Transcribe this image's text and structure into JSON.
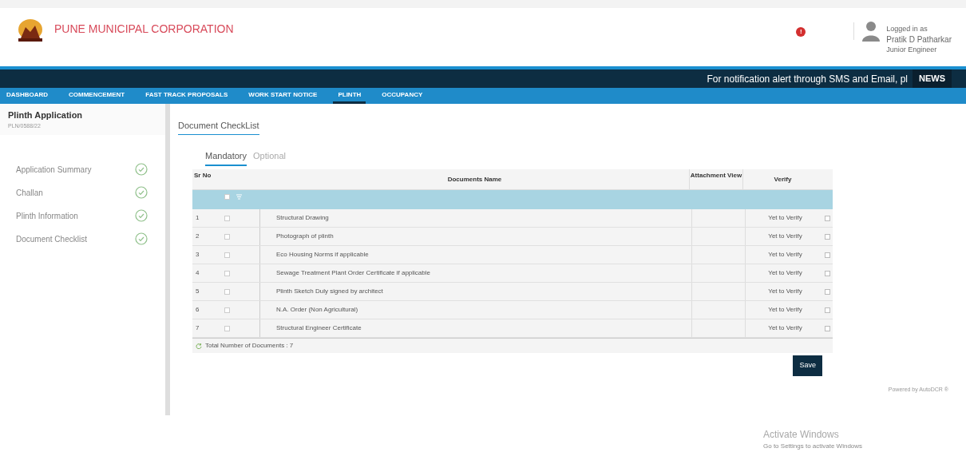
{
  "header": {
    "title": "PUNE MUNICIPAL CORPORATION",
    "alert_count": "!",
    "user": {
      "caption": "Logged in as",
      "name": "Pratik D Patharkar",
      "role": "Junior Engineer"
    }
  },
  "ticker": {
    "text": "For notification alert through SMS and Email, pl",
    "badge": "NEWS"
  },
  "nav": [
    {
      "label": "DASHBOARD",
      "selected": false
    },
    {
      "label": "COMMENCEMENT",
      "selected": false
    },
    {
      "label": "FAST TRACK PROPOSALS",
      "selected": false
    },
    {
      "label": "WORK START NOTICE",
      "selected": false
    },
    {
      "label": "PLINTH",
      "selected": true
    },
    {
      "label": "OCCUPANCY",
      "selected": false
    }
  ],
  "sidebar": {
    "title": "Plinth Application",
    "subtitle": "PLN/0588/22",
    "items": [
      {
        "label": "Application Summary",
        "done": true
      },
      {
        "label": "Challan",
        "done": true
      },
      {
        "label": "Plinth Information",
        "done": true
      },
      {
        "label": "Document Checklist",
        "done": true
      }
    ]
  },
  "page_title": "Document CheckList",
  "tabs": [
    {
      "label": "Mandatory",
      "selected": true
    },
    {
      "label": "Optional",
      "selected": false
    }
  ],
  "table": {
    "all_checked": false,
    "columns": [
      "Sr No",
      "Documents Name",
      "Attachment View",
      "Verify"
    ],
    "rows": [
      {
        "no": "1",
        "name": "Structural Drawing",
        "verify": "Yet to Verify",
        "checked": false
      },
      {
        "no": "2",
        "name": "Photograph of plinth",
        "verify": "Yet to Verify",
        "checked": false
      },
      {
        "no": "3",
        "name": "Eco Housing Norms if applicable",
        "verify": "Yet to Verify",
        "checked": false
      },
      {
        "no": "4",
        "name": "Sewage Treatment Plant  Order Certificate if applicable",
        "verify": "Yet to Verify",
        "checked": false
      },
      {
        "no": "5",
        "name": "Plinth Sketch Duly signed by architect",
        "verify": "Yet to Verify",
        "checked": false
      },
      {
        "no": "6",
        "name": "N.A. Order (Non Agricultural)",
        "verify": "Yet to Verify",
        "checked": false
      },
      {
        "no": "7",
        "name": "Structural Engineer Certificate",
        "verify": "Yet to Verify",
        "checked": false
      }
    ],
    "footer": "Total Number of Documents : 7"
  },
  "save_button": "Save",
  "powered_by": "Powered by AutoDCR ®",
  "activation": {
    "title": "Activate Windows",
    "subtitle": "Go to Settings to activate Windows"
  }
}
